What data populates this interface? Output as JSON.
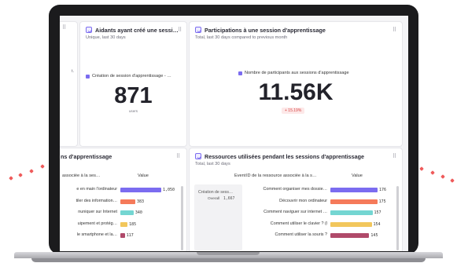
{
  "colors": {
    "accent": "#7b6cf0",
    "negative": "#d64545",
    "bar_purple": "#7b6cf0",
    "bar_orange": "#f57a5a",
    "bar_teal": "#74d6d2",
    "bar_yellow": "#f2c75c",
    "bar_maroon": "#b04a6a"
  },
  "card_left_top": {
    "menu": "⠿",
    "text": "t."
  },
  "card_aidants": {
    "title": "Aidants ayant créé une sessi…",
    "subtitle": "Unique, last 30 days",
    "menu": "⠿",
    "legend": "Création de session d'apprentissage - …",
    "value": "871",
    "unit": "users"
  },
  "card_participations": {
    "title": "Participations à une session d'apprentissage",
    "subtitle": "Total, last 30 days compared to previous month",
    "menu": "⠿",
    "legend": "Nombre de participants aux sessions d'apprentissage",
    "value": "11.56K",
    "delta": "+ 15.19%"
  },
  "card_sessions": {
    "title": "ns d'apprentissage",
    "menu": "⠿",
    "col1": "associée à la ses…",
    "col2": "Value",
    "rows": [
      {
        "label": "e en main l'ordinateur",
        "value": "1,050",
        "v": 1050
      },
      {
        "label": "tiler des information…",
        "value": "383",
        "v": 383
      },
      {
        "label": "nuniquer sur Internet",
        "value": "340",
        "v": 340
      },
      {
        "label": "uipement et protég…",
        "value": "185",
        "v": 185
      },
      {
        "label": "le smartphone et la…",
        "value": "117",
        "v": 117
      }
    ]
  },
  "card_ressources": {
    "title": "Ressources utilisées pendant les sessions d'apprentissage",
    "subtitle": "Total, last 30 days",
    "menu": "⠿",
    "col_event": "Event",
    "col_id": "ID de la ressource associée à la s…",
    "col_value": "Value",
    "event_label": "Création de sess…",
    "event_overall_label": "Overall",
    "event_overall_value": "1,667",
    "rows": [
      {
        "label": "Comment organiser mes dossie…",
        "value": "176",
        "v": 176
      },
      {
        "label": "Découvrir mon ordinateur",
        "value": "175",
        "v": 175
      },
      {
        "label": "Comment naviguer sur internet …",
        "value": "157",
        "v": 157
      },
      {
        "label": "Comment utiliser le clavier ? (l",
        "value": "154",
        "v": 154
      },
      {
        "label": "Comment utiliser la souris ?",
        "value": "145",
        "v": 145
      }
    ]
  }
}
